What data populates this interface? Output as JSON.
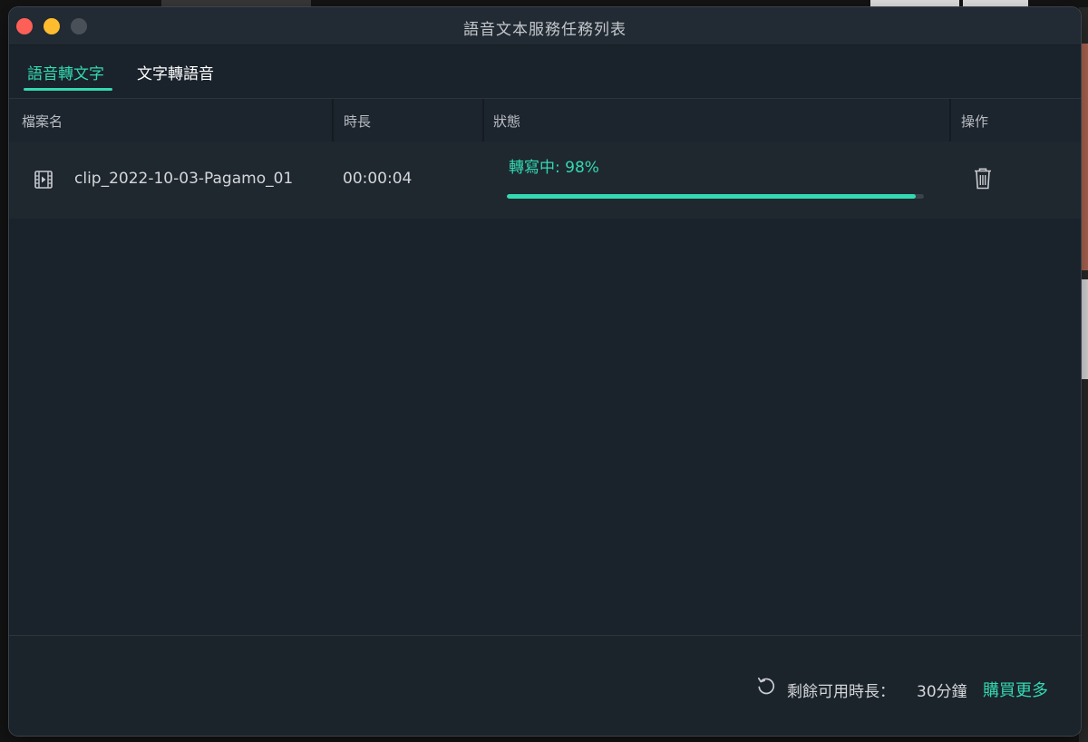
{
  "window": {
    "title": "語音文本服務任務列表"
  },
  "tabs": [
    {
      "label": "語音轉文字",
      "active": true
    },
    {
      "label": "文字轉語音",
      "active": false
    }
  ],
  "table": {
    "headers": [
      "檔案名",
      "時長",
      "狀態",
      "操作"
    ],
    "rows": [
      {
        "file_icon": "video-file-icon",
        "file_name": "clip_2022-10-03-Pagamo_01",
        "duration": "00:00:04",
        "status": "轉寫中: 98%",
        "progress_percent": 98,
        "action_icon": "trash-icon"
      }
    ]
  },
  "footer": {
    "refresh_icon": "refresh-icon",
    "remaining_label": "剩餘可用時長：",
    "remaining_value": "30分鐘",
    "buy_more": "購買更多"
  },
  "colors": {
    "accent": "#33d9b2",
    "window_bg": "#1a222b",
    "close": "#fe5f57",
    "minimize": "#febc2e"
  }
}
